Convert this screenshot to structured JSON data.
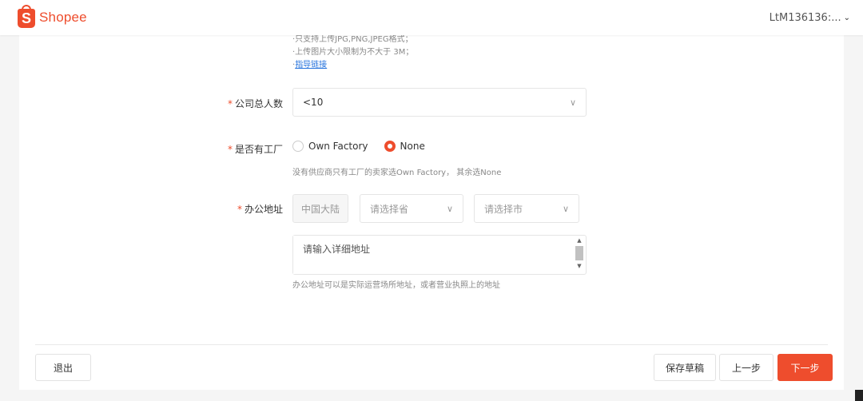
{
  "header": {
    "brand_name": "Shopee",
    "brand_letter": "S",
    "user_name": "LtM136136:..."
  },
  "hints": {
    "line1": "·只支持上传JPG,PNG,JPEG格式；",
    "line2": "·上传图片大小限制为不大于 3M；",
    "guide_link": "指导链接"
  },
  "form": {
    "required_mark": "*",
    "company_size": {
      "label": "公司总人数",
      "value": "<10"
    },
    "factory": {
      "label": "是否有工厂",
      "options": [
        "Own Factory",
        "None"
      ],
      "selected": "None",
      "note": "没有供应商只有工厂的卖家选Own Factory， 其余选None"
    },
    "office_address": {
      "label": "办公地址",
      "country": "中国大陆",
      "province_placeholder": "请选择省",
      "city_placeholder": "请选择市",
      "detail_placeholder": "请输入详细地址",
      "note": "办公地址可以是实际运营场所地址，或者营业执照上的地址"
    }
  },
  "footer": {
    "exit_label": "退出",
    "save_draft_label": "保存草稿",
    "prev_label": "上一步",
    "next_label": "下一步"
  },
  "colors": {
    "accent": "#ee4d2d",
    "link": "#2673dd"
  }
}
